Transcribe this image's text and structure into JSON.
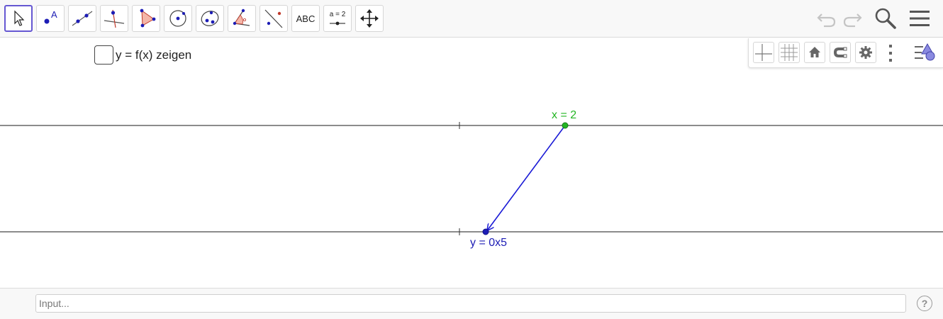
{
  "toolbar": {
    "tools": [
      {
        "name": "move-tool",
        "active": true
      },
      {
        "name": "point-tool",
        "label": "A"
      },
      {
        "name": "line-tool"
      },
      {
        "name": "perpendicular-line-tool"
      },
      {
        "name": "polygon-tool"
      },
      {
        "name": "circle-center-tool"
      },
      {
        "name": "conic-tool"
      },
      {
        "name": "angle-tool"
      },
      {
        "name": "reflect-tool"
      },
      {
        "name": "text-tool",
        "label": "ABC"
      },
      {
        "name": "slider-tool",
        "label": "a = 2"
      },
      {
        "name": "move-view-tool"
      }
    ],
    "icons": [
      "undo-icon",
      "redo-icon",
      "search-icon",
      "menu-icon"
    ]
  },
  "stylebar": {
    "icons": [
      "axes-icon",
      "grid-icon",
      "home-icon",
      "magnet-icon",
      "gear-icon",
      "more-icon",
      "style-icon"
    ]
  },
  "checkbox": {
    "label": "y = f(x) zeigen",
    "checked": false
  },
  "graphics": {
    "top_axis_label": "x = 2",
    "bottom_axis_label": "y = 0x5",
    "top_point_color": "#22b522",
    "bottom_point_color": "#1d1db5",
    "arrow_color": "#1a1ad6"
  },
  "input": {
    "placeholder": "Input..."
  },
  "help": {
    "label": "?"
  }
}
